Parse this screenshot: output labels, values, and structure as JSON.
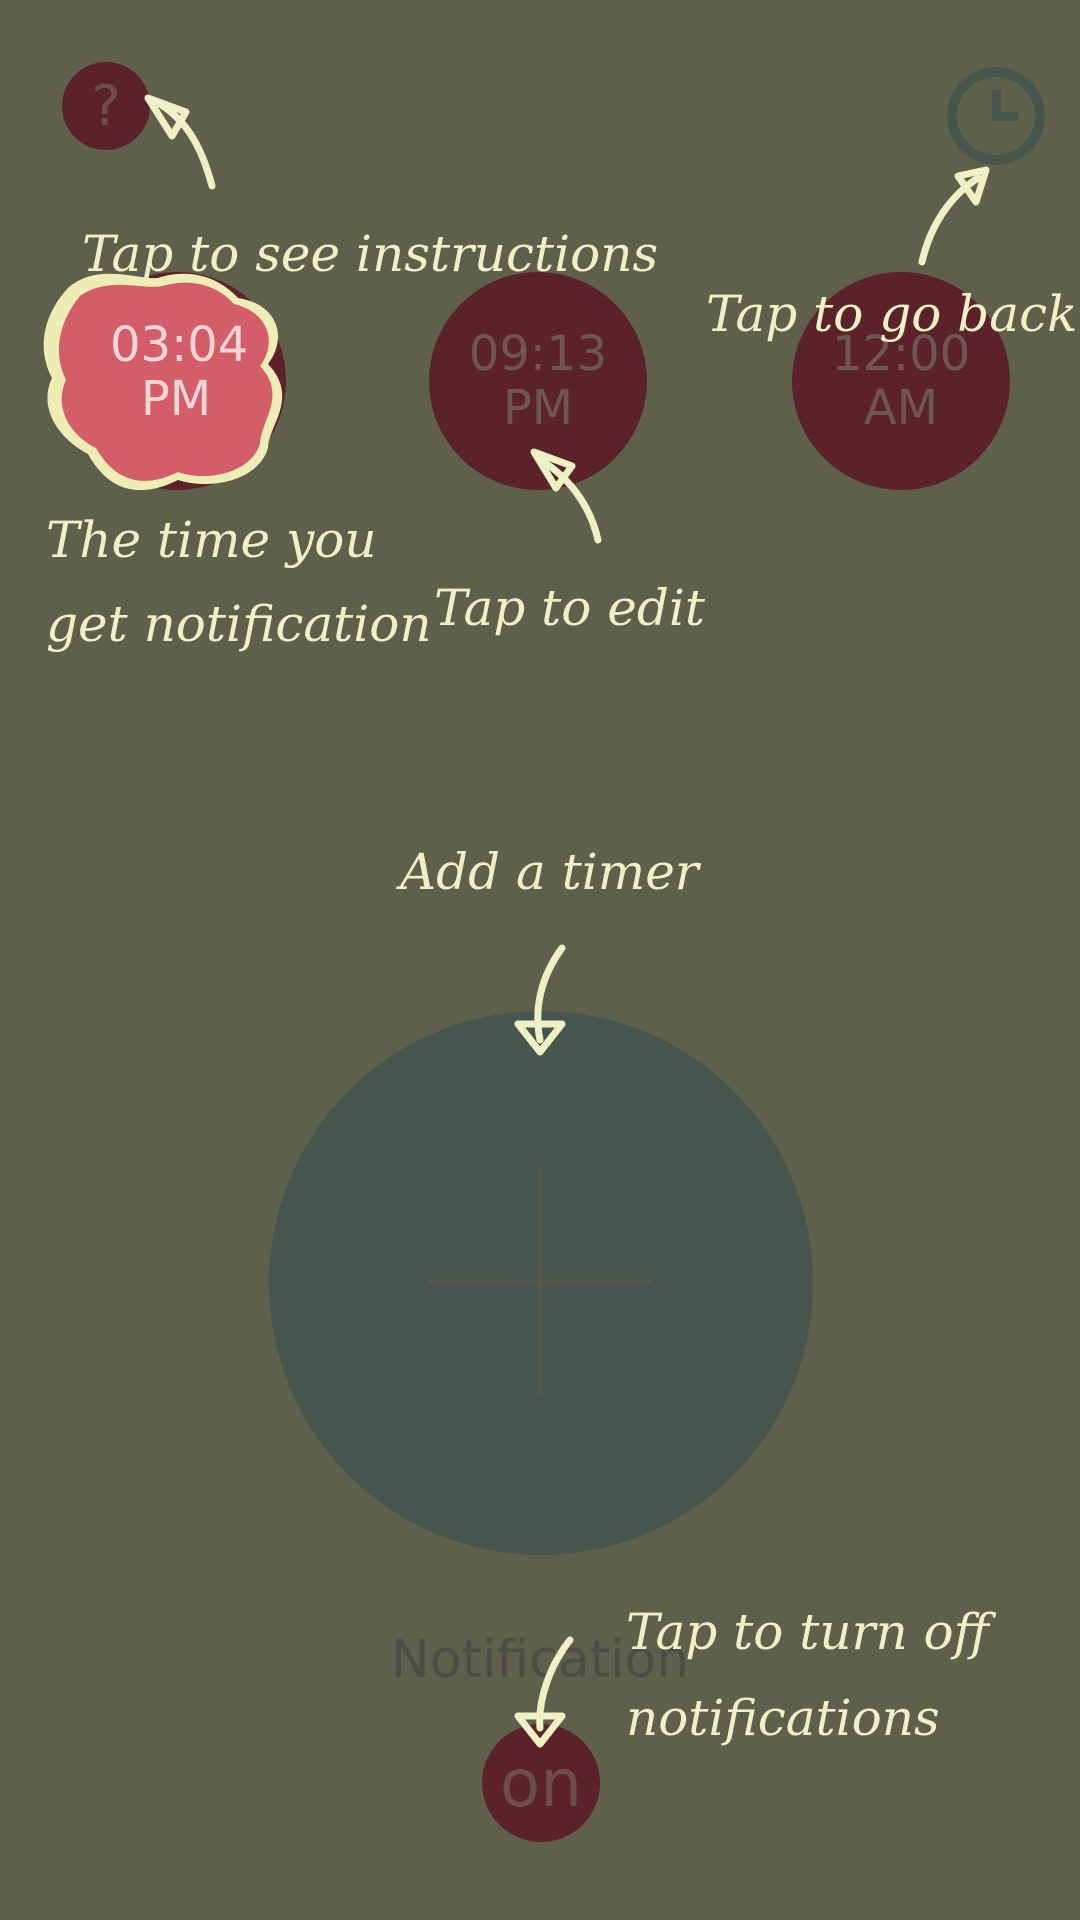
{
  "colors": {
    "background": "#5f604c",
    "circle": "#5b2329",
    "active": "#d35e69",
    "add_button": "#46564f",
    "hint_text": "#eef0c6"
  },
  "header": {
    "help_icon": "question-mark-icon",
    "help_label": "?",
    "history_icon": "clock-icon"
  },
  "timers": [
    {
      "time": "03:04",
      "period": "PM",
      "state": "active"
    },
    {
      "time": "09:13",
      "period": "PM",
      "state": "inactive"
    },
    {
      "time": "12:00",
      "period": "AM",
      "state": "inactive"
    }
  ],
  "add_timer": {
    "icon": "plus-icon"
  },
  "notification": {
    "label": "Notification",
    "toggle": "on"
  },
  "hints": {
    "instructions": "Tap to see instructions",
    "go_back": "Tap to go back",
    "time_line1": "The time you",
    "time_line2": "get notification",
    "edit": "Tap to edit",
    "add_timer": "Add a timer",
    "notif_line1": "Tap to turn off",
    "notif_line2": "notifications"
  }
}
